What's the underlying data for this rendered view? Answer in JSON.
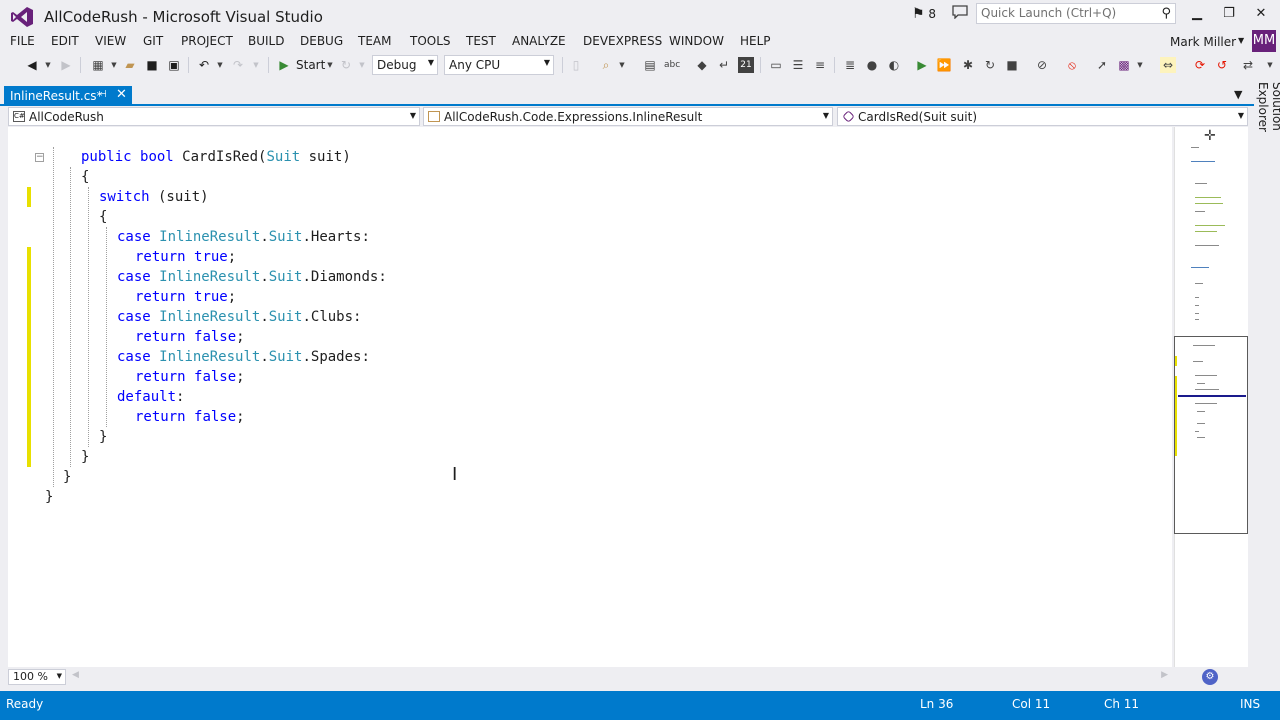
{
  "app": {
    "window_title": "AllCodeRush - Microsoft Visual Studio",
    "notification_count": "8",
    "quick_launch_placeholder": "Quick Launch (Ctrl+Q)"
  },
  "menu": [
    "FILE",
    "EDIT",
    "VIEW",
    "GIT",
    "PROJECT",
    "BUILD",
    "DEBUG",
    "TEAM",
    "TOOLS",
    "TEST",
    "ANALYZE",
    "DEVEXPRESS",
    "WINDOW",
    "HELP"
  ],
  "user": {
    "name": "Mark Miller",
    "initials": "MM"
  },
  "toolbar": {
    "start_label": "Start",
    "configuration": "Debug",
    "platform": "Any CPU"
  },
  "tab": {
    "title": "InlineResult.cs*"
  },
  "navbar": {
    "project": "AllCodeRush",
    "type": "AllCodeRush.Code.Expressions.InlineResult",
    "member": "CardIsRed(Suit suit)"
  },
  "code": {
    "line1_kw1": "public",
    "line1_kw2": "bool",
    "line1_name": "CardIsRed(",
    "line1_type": "Suit",
    "line1_rest": " suit)",
    "open1": "{",
    "switch_kw": "switch",
    "switch_rest": " (suit)",
    "open2": "{",
    "case_kw": "case",
    "class_name": "InlineResult",
    "dot": ".",
    "enum_name": "Suit",
    "hearts": ".Hearts:",
    "diamonds": ".Diamonds:",
    "clubs": ".Clubs:",
    "spades": ".Spades:",
    "return_kw": "return",
    "true_kw": "true",
    "false_kw": "false",
    "semi": ";",
    "default_kw": "default",
    "colon": ":",
    "close": "}"
  },
  "zoom": "100 %",
  "side_tab": "Solution Explorer",
  "status": {
    "state": "Ready",
    "line": "Ln 36",
    "col": "Col 11",
    "ch": "Ch 11",
    "mode": "INS"
  },
  "colors": {
    "accent": "#007acc",
    "keyword": "#0000ff",
    "type": "#2b91af",
    "change_marker": "#e8e000",
    "avatar": "#68217a"
  }
}
